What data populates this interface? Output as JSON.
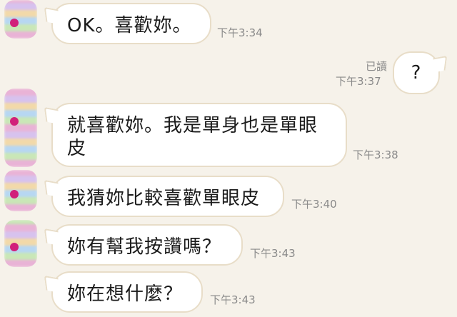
{
  "messages": [
    {
      "side": "in",
      "text": "OK。喜歡妳。",
      "time": "下午3:34"
    },
    {
      "side": "out",
      "text": "?",
      "time": "下午3:37",
      "read": "已讀"
    },
    {
      "side": "in",
      "text": "就喜歡妳。我是單身也是單眼\n皮",
      "time": "下午3:38"
    },
    {
      "side": "in",
      "text": "我猜妳比較喜歡單眼皮",
      "time": "下午3:40"
    },
    {
      "side": "in",
      "text": "妳有幫我按讚嗎？",
      "time": "下午3:43"
    },
    {
      "side": "in",
      "text": "妳在想什麼？",
      "time": "下午3:43"
    }
  ],
  "colors": {
    "background": "#f6f2ea",
    "bubble": "#ffffff",
    "bubble_border": "#e8ddc8",
    "timestamp": "#8a8a8a",
    "avatar_dot": "#d1207a"
  }
}
